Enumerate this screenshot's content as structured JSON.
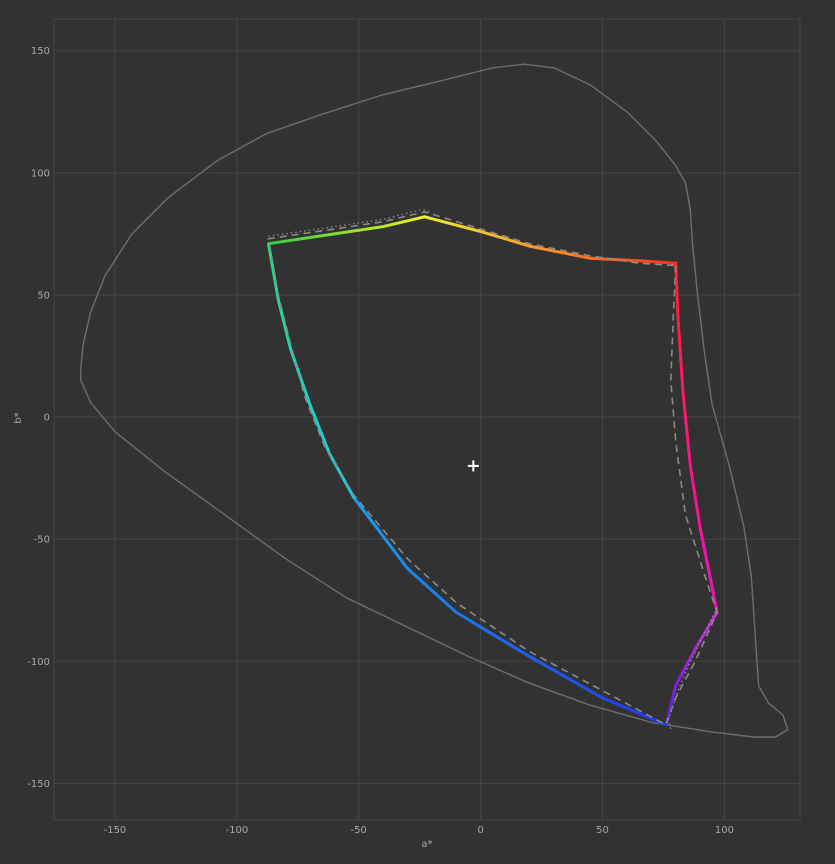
{
  "chart_data": {
    "type": "line",
    "title": "",
    "xlabel": "a*",
    "ylabel": "b*",
    "xlim": [
      -175,
      131
    ],
    "ylim": [
      -165,
      163
    ],
    "x_ticks": [
      -150,
      -100,
      -50,
      0,
      50,
      100
    ],
    "y_ticks": [
      150,
      100,
      50,
      0,
      -50,
      -100,
      -150
    ],
    "grid": true,
    "colors": {
      "background": "#323232",
      "grid": "#454545",
      "spectral_locus": "#6e6e6e",
      "reference": "#8a8a8a",
      "tick_text": "#a8a8a8",
      "white_point": "#ffffff"
    },
    "series": [
      {
        "role": "outer-boundary",
        "style": "solid",
        "points": [
          [
            -164,
            20
          ],
          [
            -163,
            30
          ],
          [
            -160,
            43
          ],
          [
            -154,
            58
          ],
          [
            -143,
            75
          ],
          [
            -128,
            90
          ],
          [
            -108,
            105
          ],
          [
            -88,
            116
          ],
          [
            -65,
            124
          ],
          [
            -40,
            132
          ],
          [
            -15,
            138
          ],
          [
            5,
            143
          ],
          [
            18,
            144.5
          ],
          [
            30,
            143
          ],
          [
            45,
            136
          ],
          [
            60,
            125
          ],
          [
            72,
            113
          ],
          [
            80,
            103
          ],
          [
            84,
            96
          ],
          [
            86,
            85
          ],
          [
            87,
            70
          ],
          [
            89,
            50
          ],
          [
            92,
            25
          ],
          [
            95,
            5
          ],
          [
            102,
            -20
          ],
          [
            108,
            -45
          ],
          [
            111,
            -65
          ],
          [
            112,
            -80
          ],
          [
            113,
            -95
          ],
          [
            114,
            -110
          ],
          [
            118,
            -117
          ],
          [
            124,
            -122
          ],
          [
            126,
            -128
          ],
          [
            121,
            -131
          ],
          [
            112,
            -131
          ],
          [
            95,
            -129
          ],
          [
            70,
            -125
          ],
          [
            45,
            -118
          ],
          [
            20,
            -109
          ],
          [
            -5,
            -98
          ],
          [
            -30,
            -86
          ],
          [
            -55,
            -74
          ],
          [
            -80,
            -58
          ],
          [
            -105,
            -40
          ],
          [
            -130,
            -22
          ],
          [
            -150,
            -6
          ],
          [
            -160,
            6
          ],
          [
            -164,
            15
          ],
          [
            -164,
            20
          ]
        ]
      },
      {
        "role": "gamut-boundary",
        "style": "colored-solid",
        "segments": [
          {
            "from_color": "#ff2030",
            "to_color": "#f010c0",
            "points": [
              [
                80,
                63
              ],
              [
                81,
                40
              ],
              [
                83,
                10
              ],
              [
                86,
                -20
              ],
              [
                90,
                -45
              ],
              [
                94,
                -65
              ],
              [
                97,
                -80
              ]
            ]
          },
          {
            "from_color": "#e020e0",
            "to_color": "#5020e0",
            "points": [
              [
                97,
                -80
              ],
              [
                88,
                -95
              ],
              [
                80,
                -110
              ],
              [
                76,
                -126
              ]
            ]
          },
          {
            "from_color": "#2038f0",
            "to_color": "#18a0f0",
            "points": [
              [
                76,
                -126
              ],
              [
                50,
                -115
              ],
              [
                20,
                -98
              ],
              [
                -10,
                -80
              ],
              [
                -30,
                -62
              ],
              [
                -52,
                -33
              ]
            ]
          },
          {
            "from_color": "#18c8f0",
            "to_color": "#20e080",
            "points": [
              [
                -52,
                -33
              ],
              [
                -62,
                -15
              ],
              [
                -70,
                5
              ],
              [
                -78,
                28
              ],
              [
                -83,
                48
              ],
              [
                -87,
                71
              ]
            ]
          },
          {
            "from_color": "#30d040",
            "to_color": "#f0f020",
            "points": [
              [
                -87,
                71
              ],
              [
                -60,
                75
              ],
              [
                -40,
                78
              ],
              [
                -23,
                82
              ]
            ]
          },
          {
            "from_color": "#f0f030",
            "to_color": "#ff3020",
            "points": [
              [
                -23,
                82
              ],
              [
                0,
                76
              ],
              [
                20,
                70
              ],
              [
                45,
                65
              ],
              [
                65,
                64
              ],
              [
                80,
                63
              ]
            ]
          }
        ]
      },
      {
        "role": "reference-boundary",
        "style": "dashed",
        "points": [
          [
            80,
            62
          ],
          [
            79,
            40
          ],
          [
            78,
            15
          ],
          [
            80,
            -10
          ],
          [
            84,
            -40
          ],
          [
            92,
            -65
          ],
          [
            97,
            -80
          ],
          [
            88,
            -100
          ],
          [
            80,
            -115
          ],
          [
            76,
            -126
          ],
          [
            50,
            -112
          ],
          [
            20,
            -96
          ],
          [
            -10,
            -76
          ],
          [
            -30,
            -58
          ],
          [
            -52,
            -32
          ],
          [
            -64,
            -12
          ],
          [
            -72,
            8
          ],
          [
            -78,
            30
          ],
          [
            -83,
            50
          ],
          [
            -87,
            73
          ],
          [
            -60,
            77
          ],
          [
            -40,
            80
          ],
          [
            -23,
            84
          ],
          [
            0,
            77
          ],
          [
            20,
            71
          ],
          [
            45,
            66
          ],
          [
            65,
            63
          ],
          [
            80,
            62
          ]
        ]
      },
      {
        "role": "secondary-reference",
        "style": "dotted",
        "points": [
          [
            -87,
            74
          ],
          [
            -60,
            78
          ],
          [
            -40,
            81
          ],
          [
            -24,
            85
          ],
          [
            -20,
            84
          ]
        ]
      },
      {
        "role": "secondary-reference",
        "style": "dotted",
        "points": [
          [
            97,
            -78
          ],
          [
            92,
            -88
          ],
          [
            86,
            -100
          ],
          [
            81,
            -112
          ],
          [
            77,
            -124
          ],
          [
            78,
            -128
          ]
        ]
      }
    ],
    "white_point": {
      "x": -3,
      "y": -20
    }
  }
}
